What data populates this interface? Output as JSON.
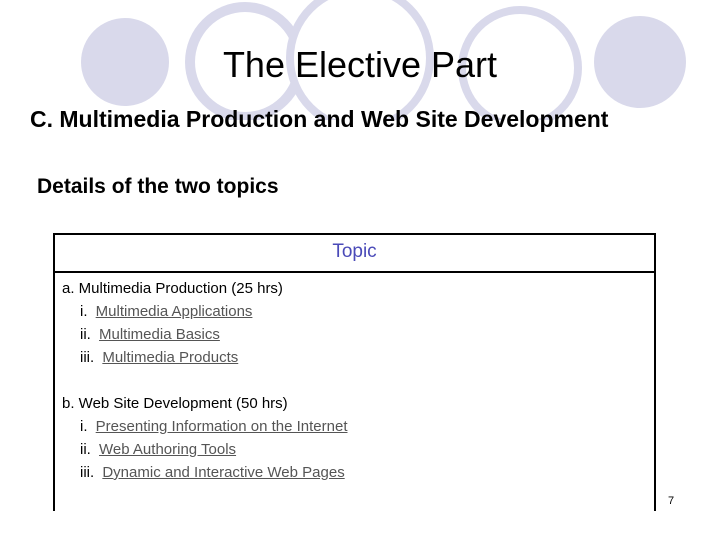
{
  "slide": {
    "title": "The Elective Part",
    "subtitle": "C.  Multimedia Production and Web Site Development",
    "section_heading": "Details of the two topics",
    "table": {
      "header": "Topic",
      "groups": [
        {
          "title": "a. Multimedia Production (25 hrs)",
          "items": [
            {
              "num": "i.",
              "label": "Multimedia Applications"
            },
            {
              "num": "ii.",
              "label": "Multimedia Basics"
            },
            {
              "num": "iii.",
              "label": "Multimedia Products"
            }
          ]
        },
        {
          "title": "b. Web Site Development (50 hrs)",
          "items": [
            {
              "num": "i.",
              "label": "Presenting Information on the Internet"
            },
            {
              "num": "ii.",
              "label": "Web Authoring Tools"
            },
            {
              "num": "iii.",
              "label": "Dynamic and Interactive Web Pages"
            }
          ]
        }
      ]
    },
    "page_number": "7",
    "decoration_color": "#d9d9eb"
  }
}
